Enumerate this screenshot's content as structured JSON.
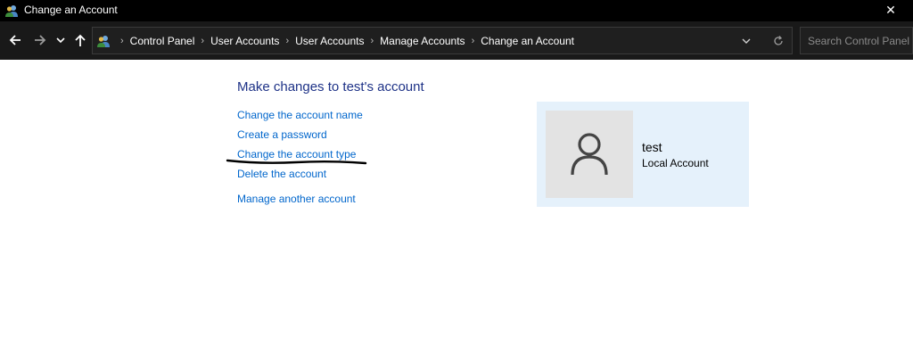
{
  "window": {
    "title": "Change an Account",
    "close_glyph": "✕"
  },
  "navigation": {
    "back_icon": "back-arrow-icon",
    "forward_icon": "forward-arrow-icon",
    "recent_icon": "chevron-down-icon",
    "up_icon": "up-arrow-icon"
  },
  "address_bar": {
    "separator": "›",
    "breadcrumbs": [
      "Control Panel",
      "User Accounts",
      "User Accounts",
      "Manage Accounts",
      "Change an Account"
    ]
  },
  "search": {
    "placeholder": "Search Control Panel"
  },
  "main": {
    "heading": "Make changes to test's account",
    "links": [
      "Change the account name",
      "Create a password",
      "Change the account type",
      "Delete the account",
      "Manage another account"
    ]
  },
  "account": {
    "name": "test",
    "type": "Local Account",
    "card_color": "#e5f1fb",
    "avatar_icon": "user-avatar-icon"
  },
  "colors": {
    "heading": "#1e3287",
    "link": "#0066cc",
    "titlebar": "#000000",
    "navbar": "#191919"
  }
}
